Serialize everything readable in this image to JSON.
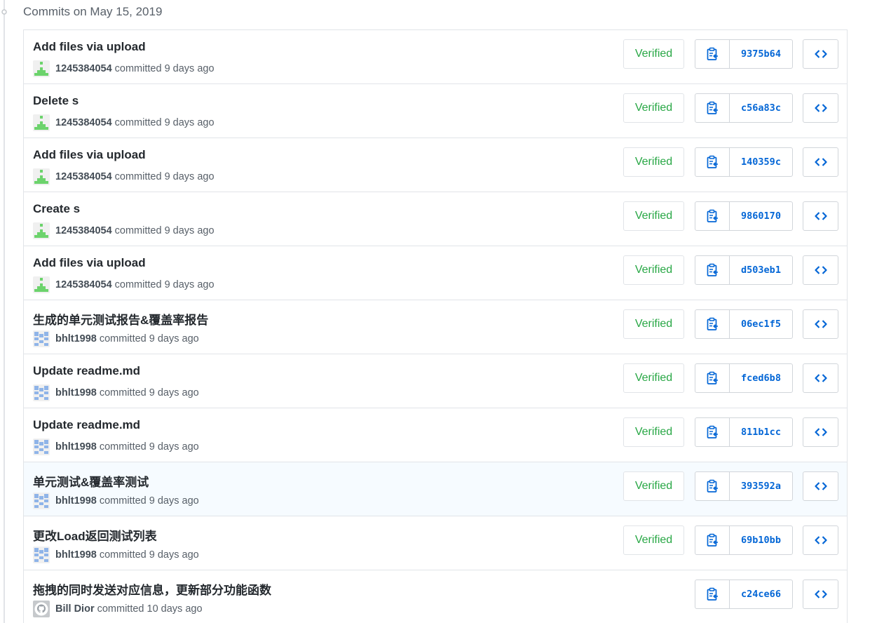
{
  "group": {
    "title": "Commits on May 15, 2019"
  },
  "colors": {
    "verified": "#28a745",
    "link": "#0366d6",
    "hover_row": "#f6fbff"
  },
  "icons": {
    "copy": "clipboard-icon",
    "browse": "code-icon",
    "timeline": "commit-dot-icon"
  },
  "commits": [
    {
      "message": "Add files via upload",
      "author": "1245384054",
      "time": "committed 9 days ago",
      "verified": "Verified",
      "sha": "9375b64",
      "avatar": "green-identicon"
    },
    {
      "message": "Delete s",
      "author": "1245384054",
      "time": "committed 9 days ago",
      "verified": "Verified",
      "sha": "c56a83c",
      "avatar": "green-identicon"
    },
    {
      "message": "Add files via upload",
      "author": "1245384054",
      "time": "committed 9 days ago",
      "verified": "Verified",
      "sha": "140359c",
      "avatar": "green-identicon"
    },
    {
      "message": "Create s",
      "author": "1245384054",
      "time": "committed 9 days ago",
      "verified": "Verified",
      "sha": "9860170",
      "avatar": "green-identicon"
    },
    {
      "message": "Add files via upload",
      "author": "1245384054",
      "time": "committed 9 days ago",
      "verified": "Verified",
      "sha": "d503eb1",
      "avatar": "green-identicon"
    },
    {
      "message": "生成的单元测试报告&覆盖率报告",
      "author": "bhlt1998",
      "time": "committed 9 days ago",
      "verified": "Verified",
      "sha": "06ec1f5",
      "avatar": "blue-identicon"
    },
    {
      "message": "Update readme.md",
      "author": "bhlt1998",
      "time": "committed 9 days ago",
      "verified": "Verified",
      "sha": "fced6b8",
      "avatar": "blue-identicon"
    },
    {
      "message": "Update readme.md",
      "author": "bhlt1998",
      "time": "committed 9 days ago",
      "verified": "Verified",
      "sha": "811b1cc",
      "avatar": "blue-identicon"
    },
    {
      "message": "单元测试&覆盖率测试",
      "author": "bhlt1998",
      "time": "committed 9 days ago",
      "verified": "Verified",
      "sha": "393592a",
      "avatar": "blue-identicon",
      "hover": true
    },
    {
      "message": "更改Load返回测试列表",
      "author": "bhlt1998",
      "time": "committed 9 days ago",
      "verified": "Verified",
      "sha": "69b10bb",
      "avatar": "blue-identicon"
    },
    {
      "message": "拖拽的同时发送对应信息，更新部分功能函数",
      "author": "Bill Dior",
      "time": "committed 10 days ago",
      "verified": "",
      "sha": "c24ce66",
      "avatar": "github-default-avatar"
    }
  ]
}
